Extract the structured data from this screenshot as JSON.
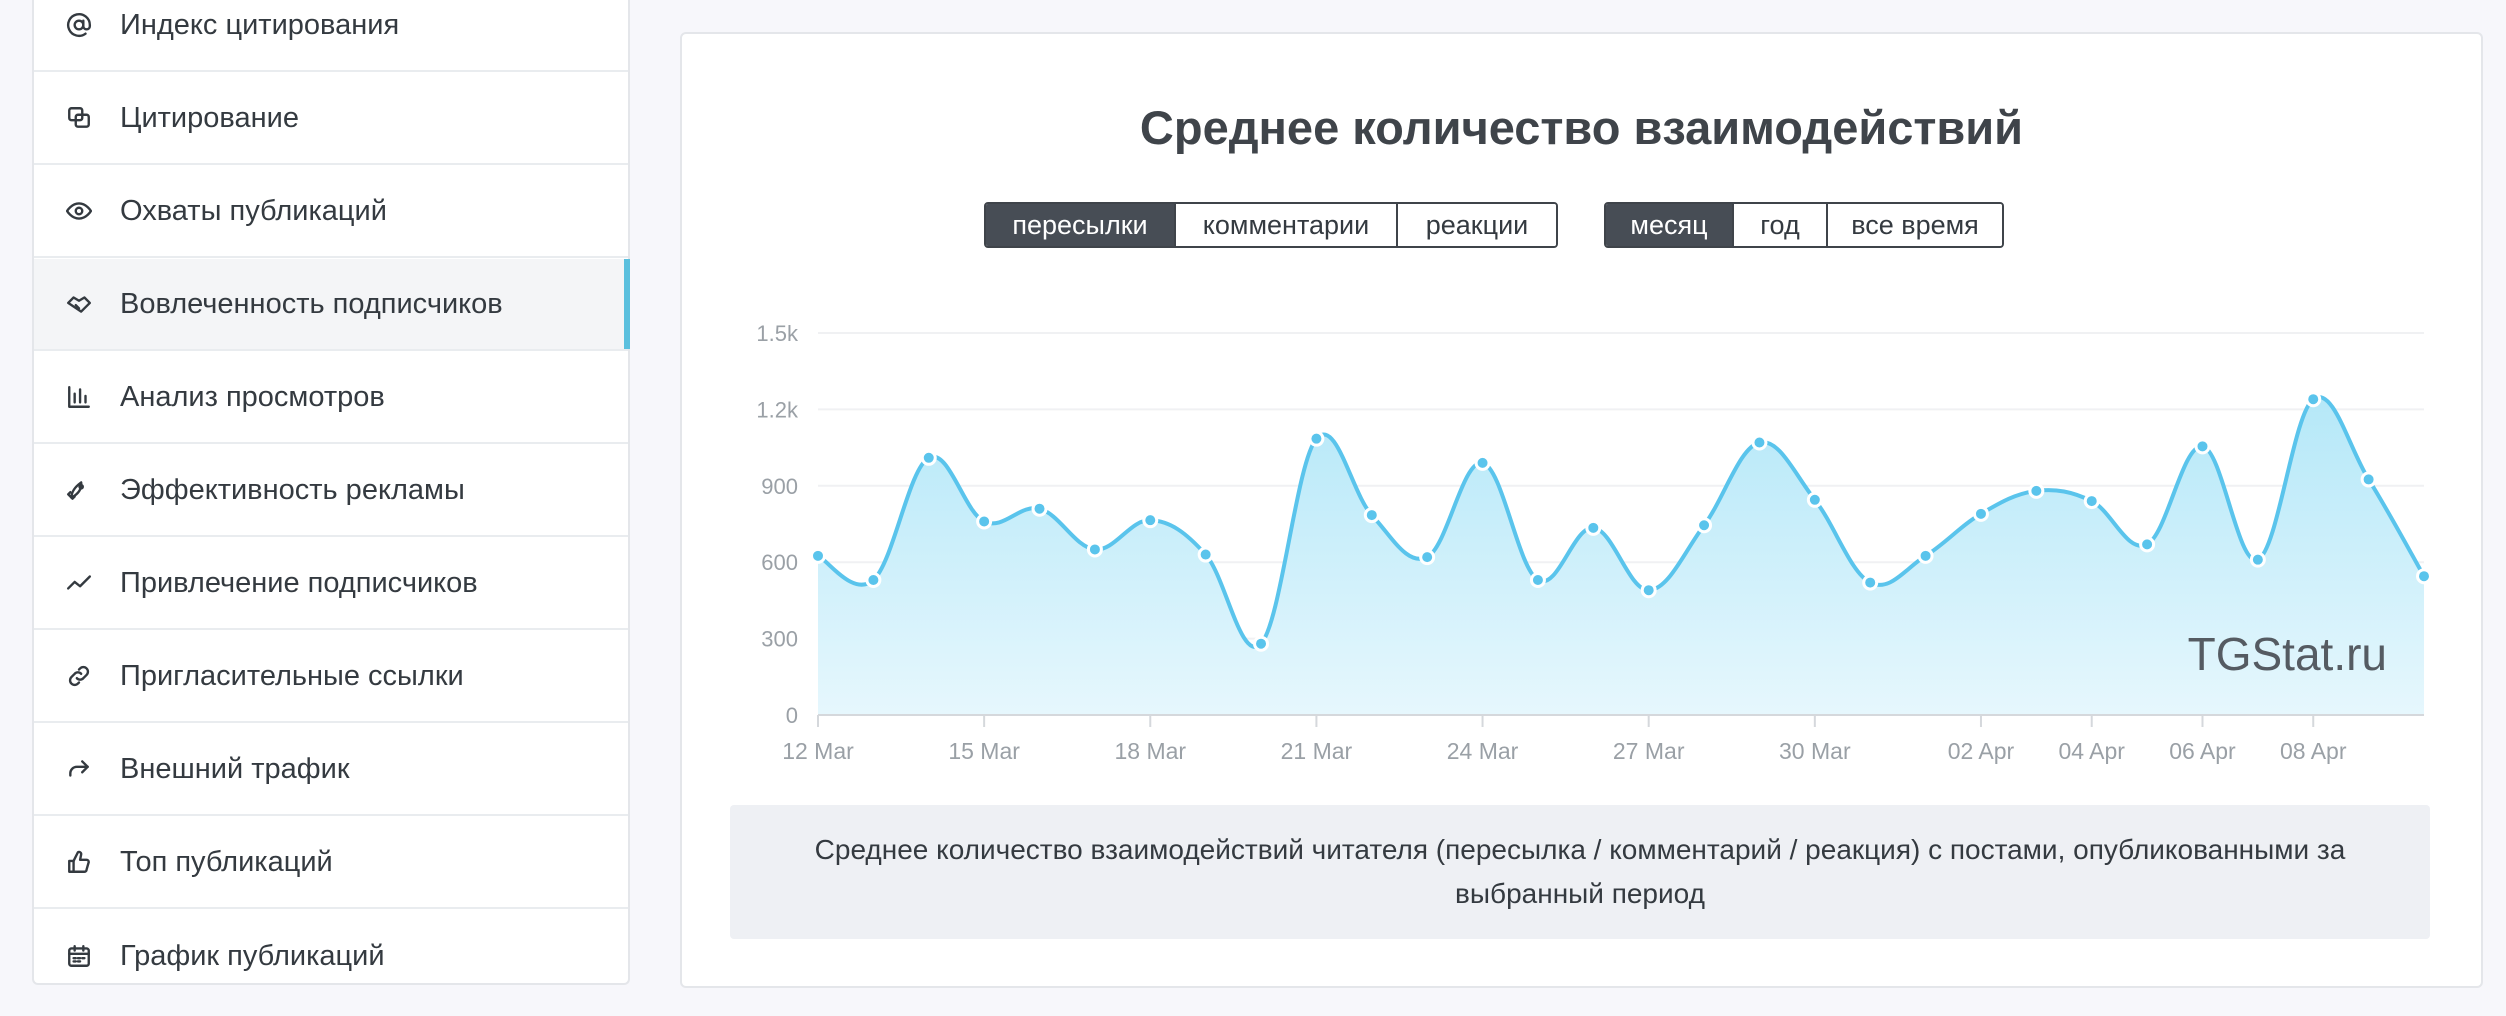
{
  "sidebar": {
    "items": [
      {
        "label": "Индекс цитирования",
        "icon": "at-icon"
      },
      {
        "label": "Цитирование",
        "icon": "quotes-icon"
      },
      {
        "label": "Охваты публикаций",
        "icon": "eye-icon"
      },
      {
        "label": "Вовлеченность подписчиков",
        "icon": "handshake-icon",
        "active": true
      },
      {
        "label": "Анализ просмотров",
        "icon": "bar-chart-icon"
      },
      {
        "label": "Эффективность рекламы",
        "icon": "rocket-icon"
      },
      {
        "label": "Привлечение подписчиков",
        "icon": "trend-icon"
      },
      {
        "label": "Пригласительные ссылки",
        "icon": "link-icon"
      },
      {
        "label": "Внешний трафик",
        "icon": "share-arrow-icon"
      },
      {
        "label": "Топ публикаций",
        "icon": "thumbs-up-icon"
      },
      {
        "label": "График публикаций",
        "icon": "calendar-icon"
      }
    ]
  },
  "card": {
    "title": "Среднее количество взаимодействий",
    "metric_tabs": [
      "пересылки",
      "комментарии",
      "реакции"
    ],
    "metric_active": "пересылки",
    "period_tabs": [
      "месяц",
      "год",
      "все время"
    ],
    "period_active": "месяц",
    "watermark": "TGStat.ru",
    "description": "Среднее количество взаимодействий читателя (пересылка / комментарий / реакция) с постами, опубликованными за выбранный период"
  },
  "colors": {
    "accent": "#5bc0de",
    "line": "#5ac4ec",
    "area_top": "#b5e8f8",
    "area_bottom": "#e6f7fd",
    "button_active": "#474d55"
  },
  "chart_data": {
    "type": "area",
    "x": [
      "12 Mar",
      "13 Mar",
      "14 Mar",
      "15 Mar",
      "16 Mar",
      "17 Mar",
      "18 Mar",
      "19 Mar",
      "20 Mar",
      "21 Mar",
      "22 Mar",
      "23 Mar",
      "24 Mar",
      "25 Mar",
      "26 Mar",
      "27 Mar",
      "28 Mar",
      "29 Mar",
      "30 Mar",
      "31 Mar",
      "01 Apr",
      "02 Apr",
      "03 Apr",
      "04 Apr",
      "05 Apr",
      "06 Apr",
      "07 Apr",
      "08 Apr",
      "09 Apr",
      "10 Apr"
    ],
    "tick_labels": [
      "12 Mar",
      "15 Mar",
      "18 Mar",
      "21 Mar",
      "24 Mar",
      "27 Mar",
      "30 Mar",
      "02 Apr",
      "04 Apr",
      "06 Apr",
      "08 Apr"
    ],
    "tick_indices": [
      0,
      3,
      6,
      9,
      12,
      15,
      18,
      21,
      23,
      25,
      27
    ],
    "series": [
      {
        "values": [
          625,
          530,
          1010,
          760,
          810,
          650,
          765,
          630,
          280,
          1085,
          785,
          620,
          990,
          530,
          735,
          490,
          745,
          1070,
          845,
          520,
          625,
          790,
          880,
          840,
          670,
          1055,
          610,
          1240,
          925,
          545
        ]
      }
    ],
    "ylim": [
      0,
      1500
    ],
    "yticks": [
      0,
      300,
      600,
      900,
      1200,
      1500
    ],
    "ytick_labels": [
      "0",
      "300",
      "600",
      "900",
      "1.2k",
      "1.5k"
    ],
    "grid": true,
    "title": "",
    "xlabel": "",
    "ylabel": ""
  }
}
